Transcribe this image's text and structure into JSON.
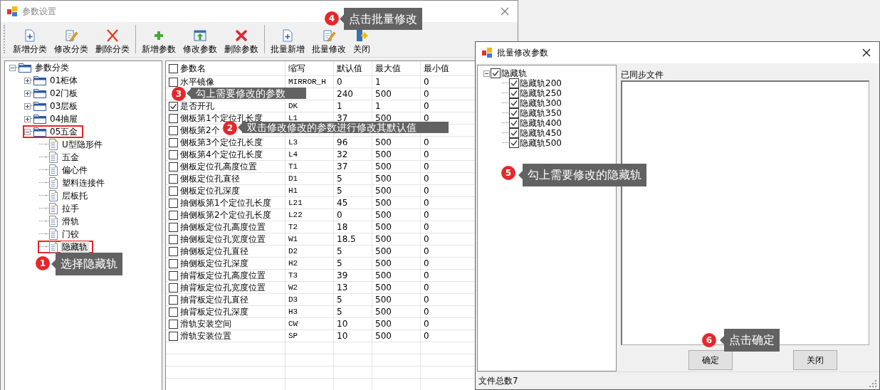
{
  "main_window": {
    "title": "参数设置"
  },
  "toolbar": {
    "groups": [
      {
        "buttons": [
          "新增分类",
          "修改分类",
          "删除分类"
        ]
      },
      {
        "buttons": [
          "新增参数",
          "修改参数",
          "删除参数"
        ]
      },
      {
        "buttons": [
          "批量新增",
          "批量修改",
          "关闭"
        ]
      }
    ]
  },
  "category_tree": {
    "label": "参数分类",
    "expanded": true,
    "selected": false,
    "highlighted": false,
    "children": [
      {
        "label": "01柜体",
        "expanded": false,
        "selected": false,
        "highlighted": false
      },
      {
        "label": "02门板",
        "expanded": false,
        "selected": false,
        "highlighted": false
      },
      {
        "label": "03层板",
        "expanded": false,
        "selected": false,
        "highlighted": false
      },
      {
        "label": "04抽屉",
        "expanded": false,
        "selected": false,
        "highlighted": false
      },
      {
        "label": "05五金",
        "expanded": true,
        "selected": false,
        "highlighted": true,
        "children": [
          {
            "label": "U型隐形件",
            "selected": false,
            "highlighted": false
          },
          {
            "label": "五金",
            "selected": false,
            "highlighted": false
          },
          {
            "label": "偏心件",
            "selected": false,
            "highlighted": false
          },
          {
            "label": "塑料连接件",
            "selected": false,
            "highlighted": false
          },
          {
            "label": "层板托",
            "selected": false,
            "highlighted": false
          },
          {
            "label": "拉手",
            "selected": false,
            "highlighted": false
          },
          {
            "label": "滑轨",
            "selected": false,
            "highlighted": false
          },
          {
            "label": "门铰",
            "selected": false,
            "highlighted": false
          },
          {
            "label": "隐藏轨",
            "selected": true,
            "highlighted": true
          }
        ]
      }
    ]
  },
  "parameter_table": {
    "header_checked": false,
    "columns": [
      "参数名",
      "缩写",
      "默认值",
      "最大值",
      "最小值"
    ],
    "rows": [
      {
        "checked": false,
        "name": "水平镜像",
        "abbr": "MIRROR_H",
        "default": "0",
        "max": "1",
        "min": "0"
      },
      {
        "default": "240",
        "max": "500",
        "min": "0"
      },
      {
        "checked": true,
        "name": "是否开孔",
        "abbr": "DK",
        "default": "1",
        "max": "1",
        "min": "0"
      },
      {
        "checked": false,
        "name": "侧板第1个定位孔长度",
        "abbr": "L1",
        "default": "37",
        "max": "500",
        "min": "0"
      },
      {
        "checked": false,
        "name": "侧板第2个"
      },
      {
        "checked": false,
        "name": "侧板第3个定位孔长度",
        "abbr": "L3",
        "default": "96",
        "max": "500",
        "min": "0"
      },
      {
        "checked": false,
        "name": "侧板第4个定位孔长度",
        "abbr": "L4",
        "default": "32",
        "max": "500",
        "min": "0"
      },
      {
        "checked": false,
        "name": "侧板定位孔高度位置",
        "abbr": "T1",
        "default": "37",
        "max": "500",
        "min": "0"
      },
      {
        "checked": false,
        "name": "侧板定位孔直径",
        "abbr": "D1",
        "default": "5",
        "max": "500",
        "min": "0"
      },
      {
        "checked": false,
        "name": "侧板定位孔深度",
        "abbr": "H1",
        "default": "5",
        "max": "500",
        "min": "0"
      },
      {
        "checked": false,
        "name": "抽侧板第1个定位孔长度",
        "abbr": "L21",
        "default": "45",
        "max": "500",
        "min": "0"
      },
      {
        "checked": false,
        "name": "抽侧板第2个定位孔长度",
        "abbr": "L22",
        "default": "0",
        "max": "500",
        "min": "0"
      },
      {
        "checked": false,
        "name": "抽侧板定位孔高度位置",
        "abbr": "T2",
        "default": "18",
        "max": "500",
        "min": "0"
      },
      {
        "checked": false,
        "name": "抽侧板定位孔宽度位置",
        "abbr": "W1",
        "default": "18.5",
        "max": "500",
        "min": "0"
      },
      {
        "checked": false,
        "name": "抽侧板定位孔直径",
        "abbr": "D2",
        "default": "5",
        "max": "500",
        "min": "0"
      },
      {
        "checked": false,
        "name": "抽侧板定位孔深度",
        "abbr": "H2",
        "default": "5",
        "max": "500",
        "min": "0"
      },
      {
        "checked": false,
        "name": "抽背板定位孔高度位置",
        "abbr": "T3",
        "default": "39",
        "max": "500",
        "min": "0"
      },
      {
        "checked": false,
        "name": "抽背板定位孔宽度位置",
        "abbr": "W2",
        "default": "13",
        "max": "500",
        "min": "0"
      },
      {
        "checked": false,
        "name": "抽背板定位孔直径",
        "abbr": "D3",
        "default": "5",
        "max": "500",
        "min": "0"
      },
      {
        "checked": false,
        "name": "抽背板定位孔深度",
        "abbr": "H3",
        "default": "5",
        "max": "500",
        "min": "0"
      },
      {
        "checked": false,
        "name": "滑轨安装空间",
        "abbr": "CW",
        "default": "10",
        "max": "500",
        "min": "0"
      },
      {
        "checked": false,
        "name": "滑轨安装位置",
        "abbr": "SP",
        "default": "10",
        "max": "500",
        "min": "0"
      }
    ]
  },
  "dialog": {
    "title": "批量修改参数",
    "tree": {
      "label": "隐藏轨",
      "checked": true,
      "expanded": true,
      "children": [
        {
          "label": "隐藏轨200",
          "checked": true
        },
        {
          "label": "隐藏轨250",
          "checked": true
        },
        {
          "label": "隐藏轨300",
          "checked": true
        },
        {
          "label": "隐藏轨350",
          "checked": true
        },
        {
          "label": "隐藏轨400",
          "checked": true
        },
        {
          "label": "隐藏轨450",
          "checked": true
        },
        {
          "label": "隐藏轨500",
          "checked": true
        }
      ]
    },
    "synced_label": "已同步文件",
    "buttons": [
      "确定",
      "关闭"
    ],
    "status": "文件总数7"
  },
  "callouts": [
    {
      "number": "1",
      "text": "选择隐藏轨"
    },
    {
      "number": "2",
      "text": "双击修改修改的参数进行修改其默认值"
    },
    {
      "number": "3",
      "text": "勾上需要修改的参数"
    },
    {
      "number": "4",
      "text": "点击批量修改"
    },
    {
      "number": "5",
      "text": "勾上需要修改的隐藏轨"
    },
    {
      "number": "6",
      "text": "点击确定"
    }
  ]
}
